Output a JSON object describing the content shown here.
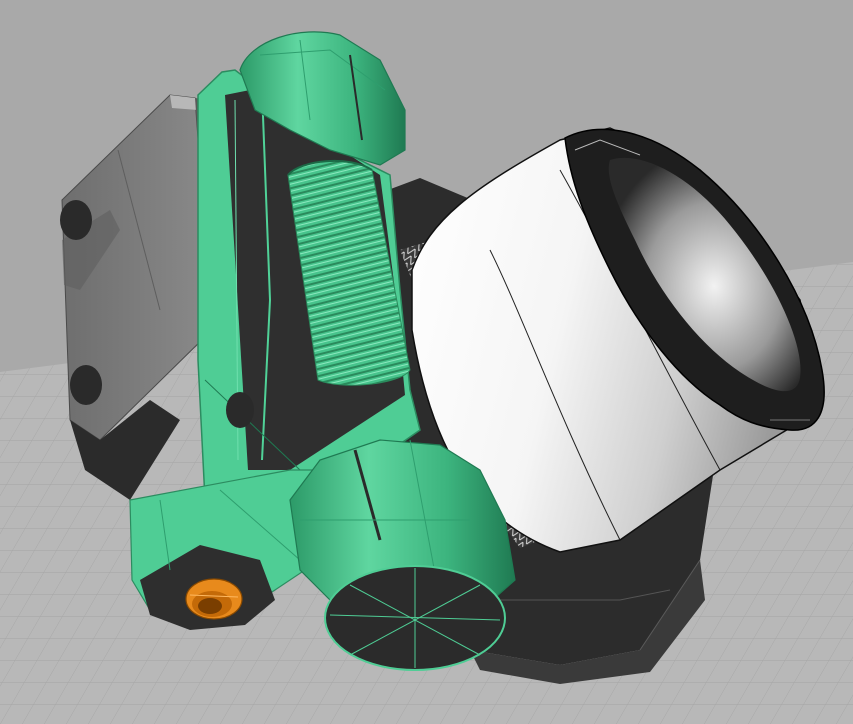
{
  "scene": {
    "kind": "3d-cad-viewport",
    "colors": {
      "background": "#a9a9a9",
      "floor": "#b9b9b9",
      "grid": "#9e9e9e",
      "selection_green": "#56d19a",
      "selection_green_dark": "#2e9e6e",
      "body_dark": "#2e2e2e",
      "block_gray": "#7d7d7d",
      "ring_white": "#f4f4f4",
      "highlight_red": "#e01010",
      "screw_orange": "#e88a1c"
    }
  }
}
